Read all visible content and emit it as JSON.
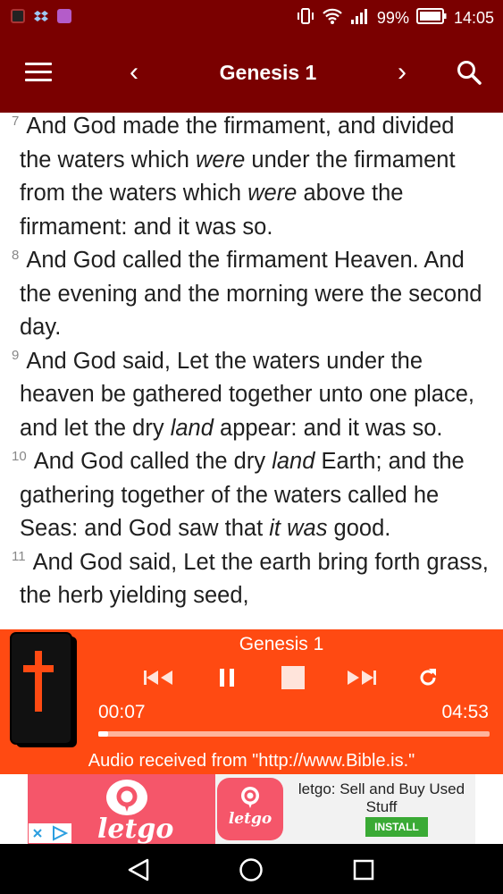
{
  "status_bar": {
    "battery": "99%",
    "time": "14:05",
    "icons": [
      "app-notification-icon",
      "dropbox-icon",
      "gallery-icon",
      "vibrate-icon",
      "wifi-icon",
      "signal-icon",
      "battery-icon"
    ]
  },
  "app_bar": {
    "title": "Genesis 1",
    "prev": "‹",
    "next": "›",
    "icons": [
      "menu-icon",
      "chevron-left-icon",
      "chevron-right-icon",
      "search-icon"
    ]
  },
  "verses": [
    {
      "num": "7",
      "parts": [
        {
          "t": "And God made the firmament, and divided the waters which ",
          "i": false
        },
        {
          "t": "were",
          "i": true
        },
        {
          "t": " under the firmament from the waters which ",
          "i": false
        },
        {
          "t": "were",
          "i": true
        },
        {
          "t": " above the firmament: and it was so.",
          "i": false
        }
      ]
    },
    {
      "num": "8",
      "parts": [
        {
          "t": "And God called the firmament Heaven. And the evening and the morning were the second day.",
          "i": false
        }
      ]
    },
    {
      "num": "9",
      "parts": [
        {
          "t": "And God said, Let the waters under the heaven be gathered together unto one place, and let the dry ",
          "i": false
        },
        {
          "t": "land",
          "i": true
        },
        {
          "t": " appear: and it was so.",
          "i": false
        }
      ]
    },
    {
      "num": "10",
      "parts": [
        {
          "t": "And God called the dry ",
          "i": false
        },
        {
          "t": "land",
          "i": true
        },
        {
          "t": " Earth; and the gathering together of the waters called he Seas: and God saw that ",
          "i": false
        },
        {
          "t": "it was",
          "i": true
        },
        {
          "t": " good.",
          "i": false
        }
      ]
    },
    {
      "num": "11",
      "parts": [
        {
          "t": "And God said, Let the earth bring forth grass, the herb yielding seed,",
          "i": false
        }
      ]
    }
  ],
  "player": {
    "title": "Genesis 1",
    "elapsed": "00:07",
    "duration": "04:53",
    "progress_fraction": 0.024,
    "source": "Audio received from \"http://www.Bible.is.\"",
    "icons": [
      "bible-icon",
      "skip-previous-icon",
      "pause-icon",
      "stop-icon",
      "skip-next-icon",
      "repeat-icon"
    ]
  },
  "ad": {
    "brand": "letgo",
    "headline": "letgo: Sell and Buy Used Stuff",
    "install": "INSTALL",
    "brand_color": "#f5566a",
    "install_color": "#3aaa35"
  },
  "nav_bar": {
    "icons": [
      "back-icon",
      "home-icon",
      "recents-icon"
    ]
  },
  "colors": {
    "app_bar": "#7a0000",
    "player": "#ff4a12",
    "text": "#1f1f1f"
  }
}
